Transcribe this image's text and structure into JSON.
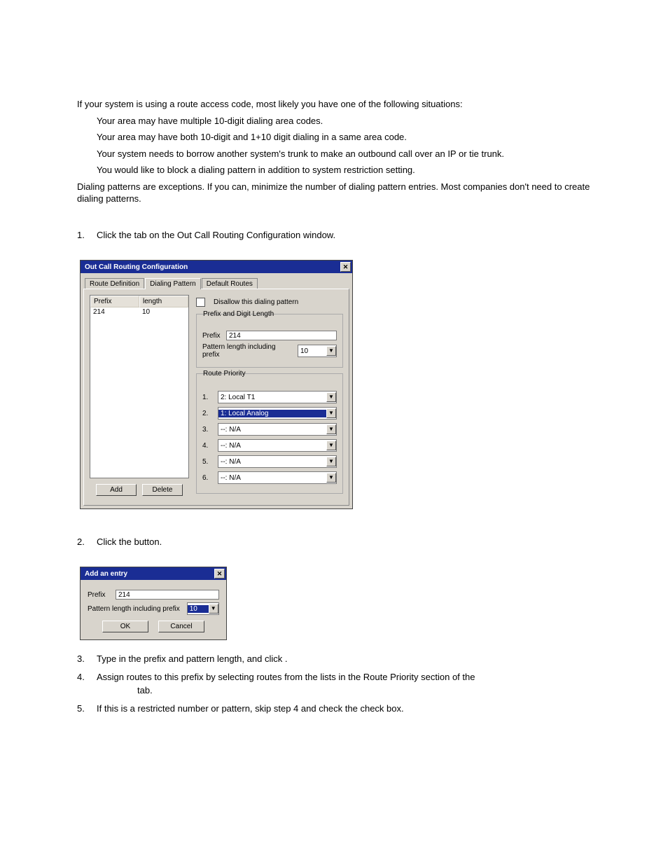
{
  "intro": {
    "p1": "If your system is using a route access code, most likely you have one of the following situations:",
    "b1": "Your area may have multiple 10-digit dialing area codes.",
    "b2": "Your area may have both 10-digit and 1+10 digit dialing in a same area code.",
    "b3": "Your system needs to borrow another system's trunk to make an outbound call over an IP or tie trunk.",
    "b4": "You would like to block a dialing pattern in addition to system restriction setting.",
    "p2": "Dialing patterns are exceptions. If you can, minimize the number of dialing pattern entries. Most companies don't need to create dialing patterns."
  },
  "steps": {
    "n1": "1.",
    "t1a": "Click the ",
    "t1b": " tab on the Out Call Routing Configuration window.",
    "n2": "2.",
    "t2a": "Click the ",
    "t2b": " button.",
    "n3": "3.",
    "t3a": "Type in the prefix and pattern length, and click ",
    "t3b": ".",
    "n4": "4.",
    "t4a": "Assign routes to this prefix by selecting routes from the lists in the Route Priority section of the",
    "t4b": " tab.",
    "n5": "5.",
    "t5a": "If this is a restricted number or pattern, skip step 4 and check the ",
    "t5b": " check box."
  },
  "dlg1": {
    "title": "Out Call Routing Configuration",
    "tabs": {
      "t1": "Route Definition",
      "t2": "Dialing Pattern",
      "t3": "Default Routes"
    },
    "list": {
      "h1": "Prefix",
      "h2": "length",
      "r1c1": "214",
      "r1c2": "10"
    },
    "disallow_label": "Disallow this dialing pattern",
    "grp_prefix_title": "Prefix and Digit Length",
    "prefix_label": "Prefix",
    "prefix_value": "214",
    "pattern_label": "Pattern length including prefix",
    "pattern_value": "10",
    "grp_priority_title": "Route Priority",
    "priority": {
      "i1": "1.",
      "v1": "2: Local T1",
      "i2": "2.",
      "v2": "1: Local Analog",
      "i3": "3.",
      "v3": "--: N/A",
      "i4": "4.",
      "v4": "--: N/A",
      "i5": "5.",
      "v5": "--: N/A",
      "i6": "6.",
      "v6": "--: N/A"
    },
    "btn_add": "Add",
    "btn_delete": "Delete"
  },
  "dlg2": {
    "title": "Add an entry",
    "prefix_label": "Prefix",
    "prefix_value": "214",
    "pattern_label": "Pattern length including prefix",
    "pattern_value": "10",
    "btn_ok": "OK",
    "btn_cancel": "Cancel"
  }
}
